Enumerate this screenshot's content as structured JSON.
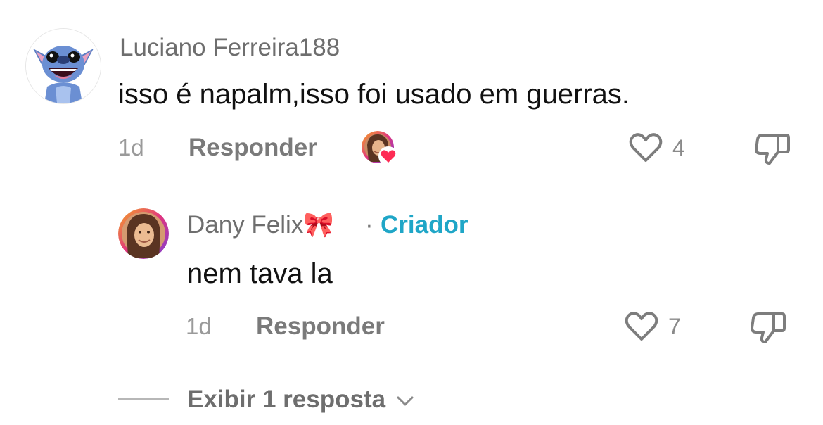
{
  "comment": {
    "username": "Luciano Ferreira188",
    "text": "isso é napalm,isso foi usado em guerras.",
    "time": "1d",
    "reply_label": "Responder",
    "like_count": "4",
    "icons": {
      "avatar": "stitch-avatar",
      "liked_by_creator": "creator-heart-avatar",
      "like": "heart-outline-icon",
      "dislike": "thumbs-down-icon"
    }
  },
  "reply": {
    "username": "Dany Felix🎀",
    "separator": "·",
    "badge": "Criador",
    "text": "nem tava la",
    "time": "1d",
    "reply_label": "Responder",
    "like_count": "7",
    "icons": {
      "avatar": "creator-avatar",
      "like": "heart-outline-icon",
      "dislike": "thumbs-down-icon"
    }
  },
  "view_more": {
    "label": "Exibir 1 resposta",
    "icon": "chevron-down-icon"
  },
  "colors": {
    "creator_badge": "#1fa6c7",
    "mini_heart": "#fe2c55",
    "muted_text": "#6e6e6e"
  }
}
